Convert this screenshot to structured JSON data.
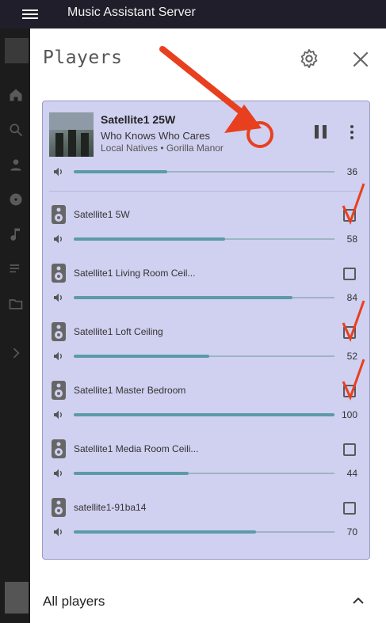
{
  "app": {
    "title": "Music Assistant Server"
  },
  "panel": {
    "title": "Players"
  },
  "now_playing": {
    "player_name": "Satellite1 25W",
    "track": "Who Knows Who Cares",
    "artist_album": "Local Natives • Gorilla Manor",
    "volume": 36
  },
  "players": [
    {
      "name": "Satellite1 5W",
      "volume": 58,
      "checked": false
    },
    {
      "name": "Satellite1 Living Room Ceil...",
      "volume": 84,
      "checked": false
    },
    {
      "name": "Satellite1 Loft Ceiling",
      "volume": 52,
      "checked": false
    },
    {
      "name": "Satellite1 Master Bedroom",
      "volume": 100,
      "checked": false
    },
    {
      "name": "Satellite1 Media Room Ceili...",
      "volume": 44,
      "checked": false
    },
    {
      "name": "satellite1-91ba14",
      "volume": 70,
      "checked": false
    }
  ],
  "all_players": {
    "label": "All players"
  },
  "colors": {
    "group_bg": "#d0d0f0",
    "slider_fill": "#5b9ba8",
    "annotation": "#e8401f"
  }
}
